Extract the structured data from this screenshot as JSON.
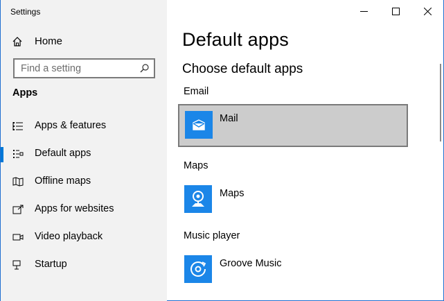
{
  "window": {
    "title": "Settings",
    "controls": [
      "minimize",
      "maximize",
      "close"
    ]
  },
  "sidebar": {
    "home_label": "Home",
    "search_placeholder": "Find a setting",
    "section_title": "Apps",
    "items": [
      {
        "label": "Apps & features",
        "icon": "list-icon",
        "selected": false
      },
      {
        "label": "Default apps",
        "icon": "list-check-icon",
        "selected": true
      },
      {
        "label": "Offline maps",
        "icon": "map-icon",
        "selected": false
      },
      {
        "label": "Apps for websites",
        "icon": "link-window-icon",
        "selected": false
      },
      {
        "label": "Video playback",
        "icon": "video-icon",
        "selected": false
      },
      {
        "label": "Startup",
        "icon": "startup-icon",
        "selected": false
      }
    ]
  },
  "main": {
    "page_title": "Default apps",
    "subtitle": "Choose default apps",
    "groups": [
      {
        "label": "Email",
        "app": "Mail",
        "icon": "mail-icon",
        "selected": true
      },
      {
        "label": "Maps",
        "app": "Maps",
        "icon": "maps-icon",
        "selected": false
      },
      {
        "label": "Music player",
        "app": "Groove Music",
        "icon": "groove-icon",
        "selected": false
      }
    ]
  },
  "colors": {
    "accent": "#0078d7",
    "tile": "#1b86e8",
    "sidebar_bg": "#f2f2f2",
    "selected_tile_bg": "#cccccc"
  }
}
